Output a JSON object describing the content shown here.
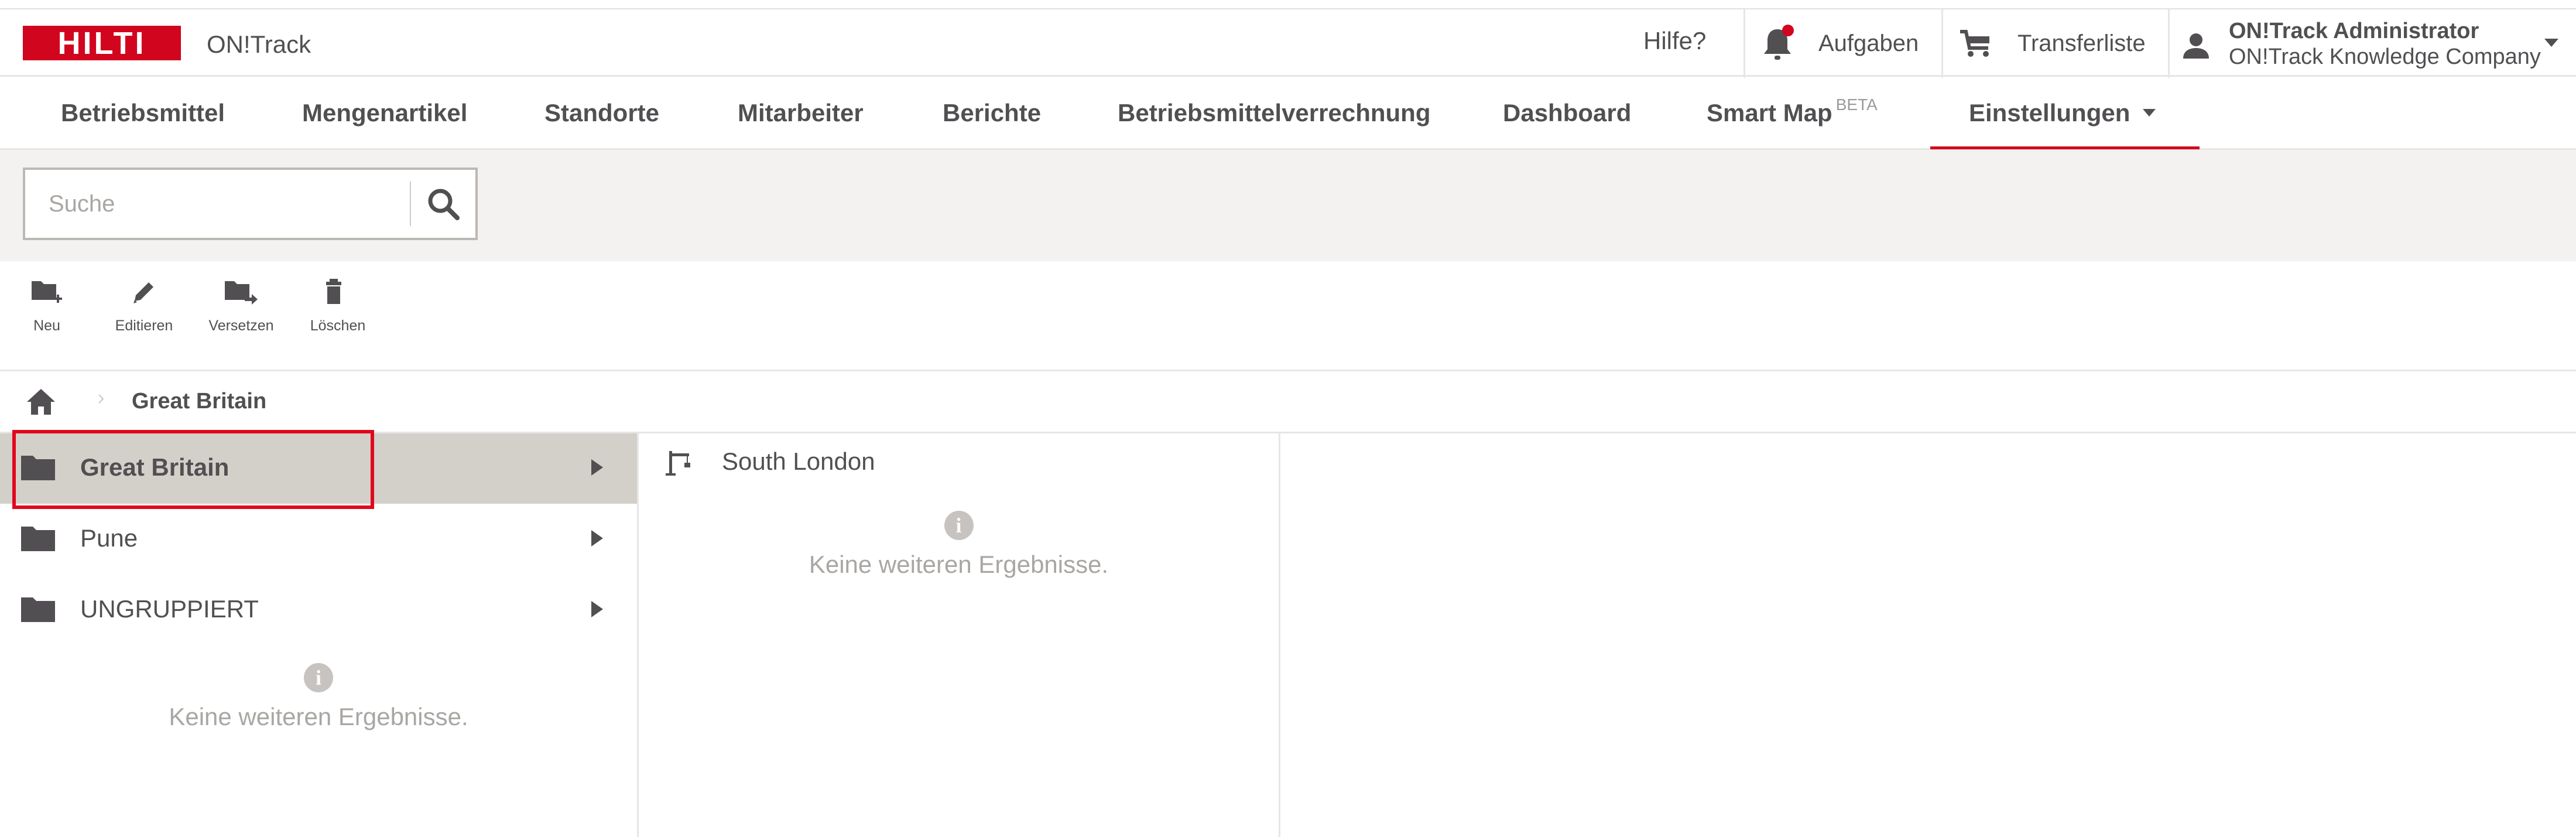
{
  "header": {
    "logo_text": "HILTI",
    "app_title": "ON!Track",
    "help_label": "Hilfe?",
    "tasks_label": "Aufgaben",
    "transfer_label": "Transferliste",
    "user_name": "ON!Track Administrator",
    "user_company": "ON!Track Knowledge Company",
    "brand_color": "#d2051e"
  },
  "nav": {
    "items": [
      {
        "label": "Betriebsmittel"
      },
      {
        "label": "Mengenartikel"
      },
      {
        "label": "Standorte"
      },
      {
        "label": "Mitarbeiter"
      },
      {
        "label": "Berichte"
      },
      {
        "label": "Betriebsmittelverrechnung"
      },
      {
        "label": "Dashboard"
      },
      {
        "label": "Smart Map",
        "badge": "BETA"
      },
      {
        "label": "Einstellungen",
        "active": true
      }
    ]
  },
  "search": {
    "placeholder": "Suche",
    "value": ""
  },
  "toolbar": {
    "new_label": "Neu",
    "edit_label": "Editieren",
    "move_label": "Versetzen",
    "delete_label": "Löschen"
  },
  "breadcrumb": {
    "current": "Great Britain"
  },
  "groups": {
    "items": [
      {
        "label": "Great Britain",
        "selected": true
      },
      {
        "label": "Pune",
        "selected": false
      },
      {
        "label": "UNGRUPPIERT",
        "selected": false
      }
    ],
    "empty_message": "Keine weiteren Ergebnisse."
  },
  "locations": {
    "items": [
      {
        "label": "South London"
      }
    ],
    "empty_message": "Keine weiteren Ergebnisse."
  }
}
